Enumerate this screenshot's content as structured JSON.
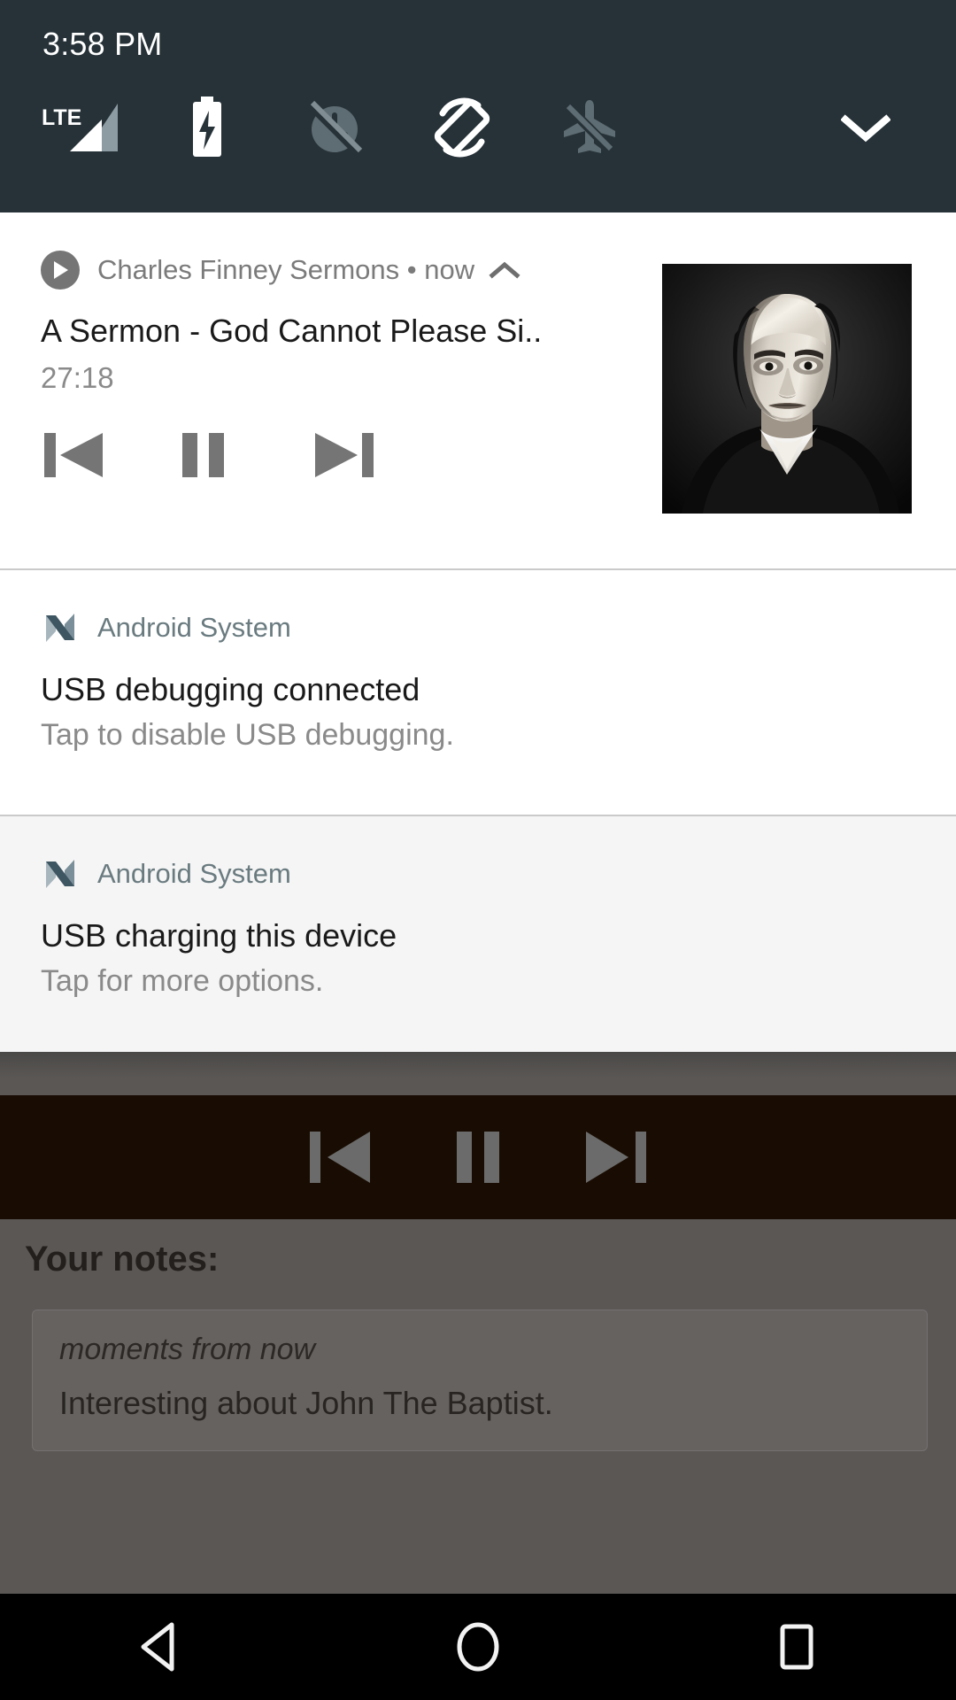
{
  "status_bar": {
    "time": "3:58 PM",
    "icons": [
      {
        "name": "lte-signal-icon",
        "label": "LTE"
      },
      {
        "name": "battery-charging-icon",
        "label": "Battery charging"
      },
      {
        "name": "alarm-off-icon",
        "label": "Alarm off"
      },
      {
        "name": "screen-rotation-icon",
        "label": "Auto-rotate"
      },
      {
        "name": "airplane-mode-off-icon",
        "label": "Airplane mode off"
      },
      {
        "name": "chevron-down-icon",
        "label": "Expand quick settings"
      }
    ],
    "background_color": "#263238"
  },
  "shade": {
    "media_notification": {
      "app_name": "Charles Finney Sermons",
      "separator": "•",
      "time": "now",
      "title": "A Sermon - God Cannot Please Si..",
      "duration": "27:18",
      "collapse_label": "Collapse",
      "controls": [
        {
          "name": "previous-button",
          "label": "Previous"
        },
        {
          "name": "pause-button",
          "label": "Pause"
        },
        {
          "name": "next-button",
          "label": "Next"
        }
      ],
      "album_art_alt": "Portrait of Charles Finney",
      "background_color": "#ffffff"
    },
    "system_notifications": [
      {
        "app_name": "Android System",
        "title": "USB debugging connected",
        "body": "Tap to disable USB debugging.",
        "background_color": "#ffffff"
      },
      {
        "app_name": "Android System",
        "title": "USB charging this device",
        "body": "Tap for more options.",
        "background_color": "#f5f5f5"
      }
    ]
  },
  "app_behind": {
    "media_bar": {
      "background_color": "#190c02",
      "controls": [
        {
          "name": "previous-button",
          "label": "Previous"
        },
        {
          "name": "pause-button",
          "label": "Pause"
        },
        {
          "name": "next-button",
          "label": "Next"
        }
      ]
    },
    "notes": {
      "heading": "Your notes:",
      "items": [
        {
          "timestamp": "moments from now",
          "text": "Interesting about John The Baptist."
        }
      ]
    }
  },
  "nav_bar": {
    "background_color": "#000000",
    "buttons": [
      {
        "name": "back-button",
        "label": "Back"
      },
      {
        "name": "home-button",
        "label": "Home"
      },
      {
        "name": "recents-button",
        "label": "Recents"
      }
    ]
  }
}
